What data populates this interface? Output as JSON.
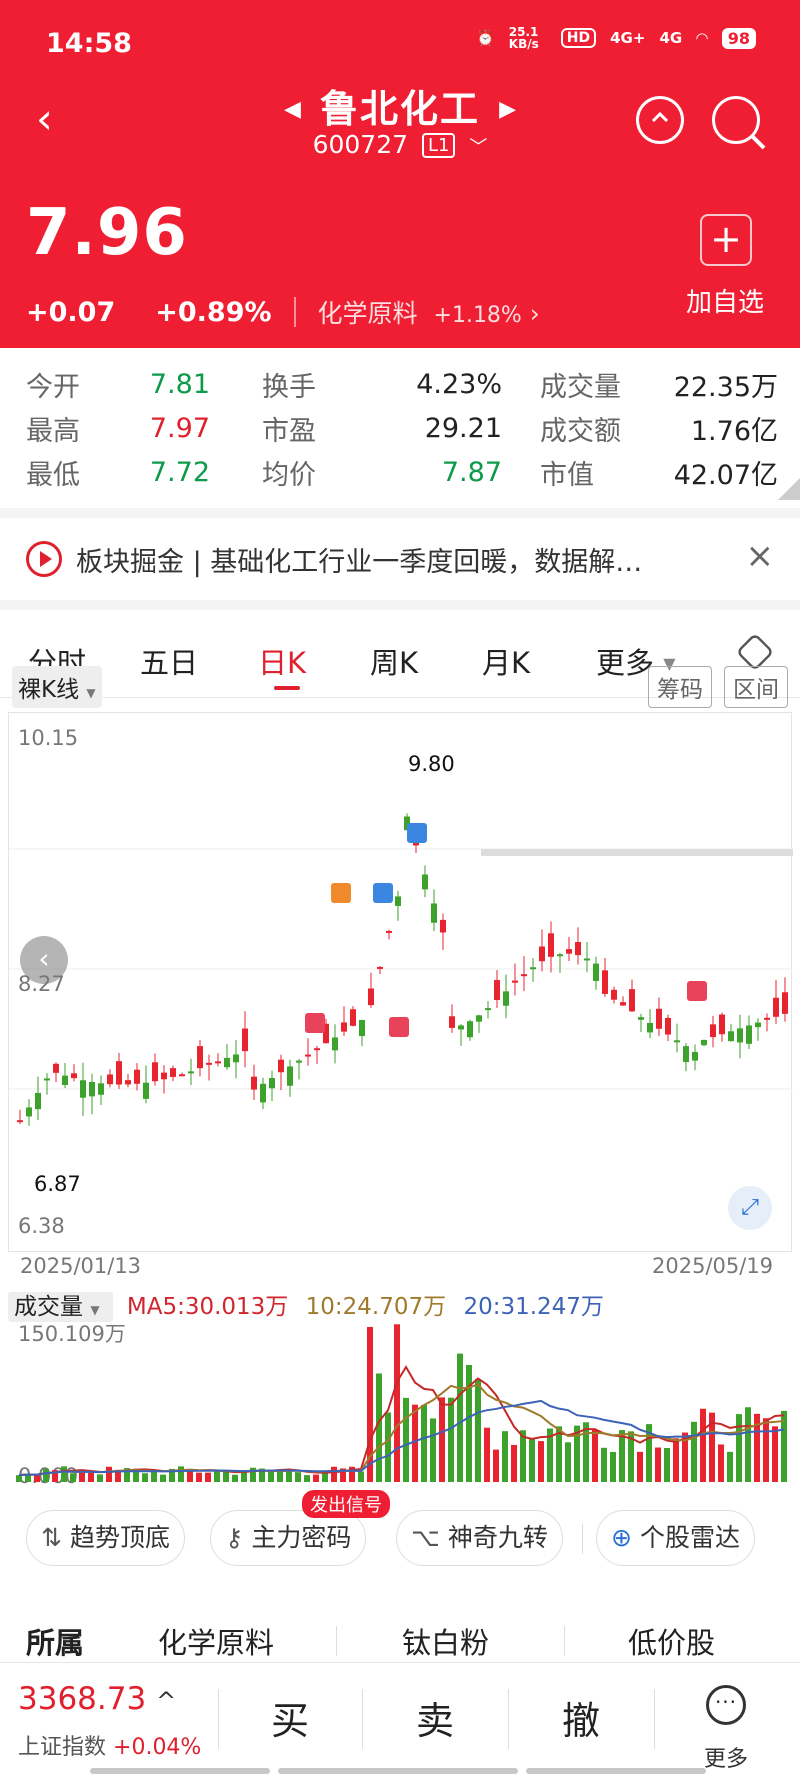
{
  "status": {
    "time": "14:58",
    "speed": "25.1 KB/s",
    "hd": "HD",
    "net1": "4G+",
    "net2": "4G",
    "battery": "98"
  },
  "header": {
    "name": "鲁北化工",
    "code": "600727",
    "level": "L1",
    "price": "7.96",
    "change": "+0.07",
    "change_pct": "+0.89%",
    "sector": "化学原料",
    "sector_pct": "+1.18%",
    "add_label": "加自选",
    "add_icon": "+"
  },
  "quote": [
    [
      {
        "label": "今开",
        "value": "7.81",
        "color": "green"
      },
      {
        "label": "换手",
        "value": "4.23%",
        "color": "normal"
      },
      {
        "label": "成交量",
        "value": "22.35万",
        "color": "normal"
      }
    ],
    [
      {
        "label": "最高",
        "value": "7.97",
        "color": "red"
      },
      {
        "label": "市盈",
        "value": "29.21",
        "color": "normal"
      },
      {
        "label": "成交额",
        "value": "1.76亿",
        "color": "normal"
      }
    ],
    [
      {
        "label": "最低",
        "value": "7.72",
        "color": "green"
      },
      {
        "label": "均价",
        "value": "7.87",
        "color": "green"
      },
      {
        "label": "市值",
        "value": "42.07亿",
        "color": "normal"
      }
    ]
  ],
  "news": {
    "text": "板块掘金 | 基础化工行业一季度回暖，数据解…",
    "close": "×"
  },
  "tabs": [
    "分时",
    "五日",
    "日K",
    "周K",
    "月K",
    "更多"
  ],
  "active_tab": "日K",
  "chart_controls": {
    "kline_type": "裸K线",
    "chips": "筹码",
    "range": "区间"
  },
  "chart": {
    "y_top": "10.15",
    "y_mid": "8.27",
    "y_bottom": "6.38",
    "date_start": "2025/01/13",
    "date_end": "2025/05/19",
    "high_label": "9.80",
    "low_label": "6.87",
    "markers": [
      "T",
      "S",
      "S",
      "B",
      "B",
      "B"
    ]
  },
  "volume": {
    "label": "成交量",
    "ma5": "MA5:30.013万",
    "ma10": "10:24.707万",
    "ma20": "20:31.247万",
    "max": "150.109万",
    "min": "0.000"
  },
  "chart_data": {
    "type": "candlestick",
    "x_range": [
      "2025/01/13",
      "2025/05/19"
    ],
    "ylim": [
      6.38,
      10.15
    ],
    "high": 9.8,
    "low": 6.87,
    "volume_range": [
      0,
      150.109
    ],
    "volume_unit": "万"
  },
  "tools": [
    {
      "icon": "⇅",
      "label": "趋势顶底"
    },
    {
      "icon": "⚷",
      "label": "主力密码"
    },
    {
      "icon": "⌥",
      "label": "神奇九转"
    },
    {
      "icon": "⊕",
      "label": "个股雷达"
    }
  ],
  "tool_badge": "发出信号",
  "sectors": {
    "title": "所属",
    "items": [
      "化学原料",
      "钛白粉",
      "低价股"
    ]
  },
  "bottom": {
    "index_value": "3368.73",
    "index_arrow": "^",
    "index_name": "上证指数",
    "index_change": "+0.04%",
    "buy": "买",
    "sell": "卖",
    "cancel": "撤",
    "more": "更多"
  }
}
